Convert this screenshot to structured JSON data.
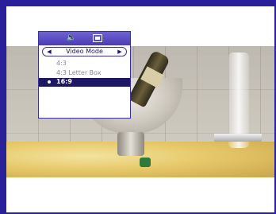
{
  "osd": {
    "icons": [
      "speaker-icon",
      "screen-icon"
    ],
    "mode_label": "Video Mode",
    "arrow_left": "◀",
    "arrow_right": "▶",
    "options": [
      {
        "label": "4:3",
        "selected": false
      },
      {
        "label": "4:3 Letter Box",
        "selected": false
      },
      {
        "label": "16:9",
        "selected": true
      }
    ]
  },
  "colors": {
    "frame_border": "#2a2099",
    "osd_header": "#4a3cb5",
    "selected_row": "#1e1763"
  }
}
